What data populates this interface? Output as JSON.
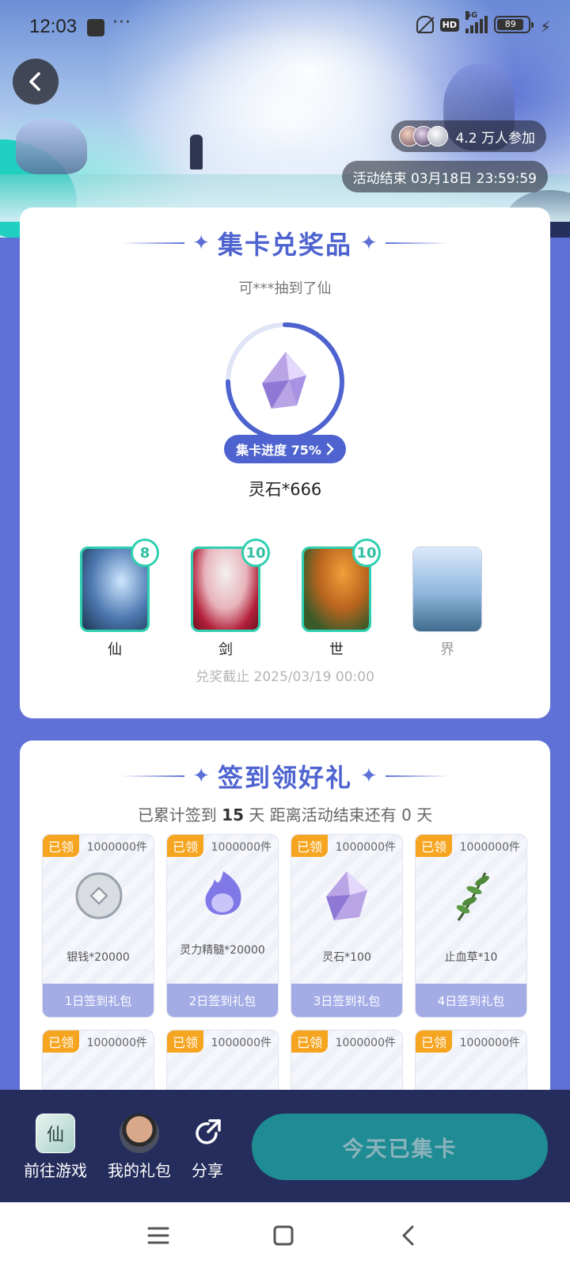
{
  "status_bar": {
    "time": "12:03",
    "dots": "···",
    "hd": "HD",
    "network": "5G",
    "battery": "89"
  },
  "hero": {
    "participants": "4.2 万人参加",
    "end_time": "活动结束 03月18日 23:59:59"
  },
  "collect_section": {
    "title": "集卡兑奖品",
    "ticker": "可***抽到了仙",
    "progress_label": "集卡进度 75%",
    "progress": 0.75,
    "prize_name": "灵石*666",
    "cards": [
      {
        "label": "仙",
        "count": "8"
      },
      {
        "label": "剑",
        "count": "10"
      },
      {
        "label": "世",
        "count": "10"
      },
      {
        "label": "界",
        "count": ""
      }
    ],
    "deadline": "兑奖截止 2025/03/19 00:00"
  },
  "signin_section": {
    "title": "签到领好礼",
    "summary_prefix": "已累计签到",
    "summary_days": "15",
    "summary_middle": "天  距离活动结束还有",
    "summary_remaining": "0",
    "summary_suffix": "天",
    "gifts": [
      {
        "claimed": "已领",
        "qty": "1000000件",
        "name": "银钱*20000",
        "pack": "1日签到礼包"
      },
      {
        "claimed": "已领",
        "qty": "1000000件",
        "name": "灵力精髓*20000",
        "pack": "2日签到礼包"
      },
      {
        "claimed": "已领",
        "qty": "1000000件",
        "name": "灵石*100",
        "pack": "3日签到礼包"
      },
      {
        "claimed": "已领",
        "qty": "1000000件",
        "name": "止血草*10",
        "pack": "4日签到礼包"
      },
      {
        "claimed": "已领",
        "qty": "1000000件",
        "name": "",
        "pack": ""
      },
      {
        "claimed": "已领",
        "qty": "1000000件",
        "name": "",
        "pack": ""
      },
      {
        "claimed": "已领",
        "qty": "1000000件",
        "name": "",
        "pack": ""
      },
      {
        "claimed": "已领",
        "qty": "1000000件",
        "name": "",
        "pack": ""
      }
    ]
  },
  "action_bar": {
    "go_game": "前往游戏",
    "my_gifts": "我的礼包",
    "share": "分享",
    "checkin_button": "今天已集卡"
  },
  "colors": {
    "primary": "#4e63cf",
    "page_bg": "#5f70d6",
    "teal": "#2fd0b0",
    "claimed_orange": "#f6a520",
    "action_bar": "#252d5c",
    "checkin_button": "#1f8c93"
  }
}
